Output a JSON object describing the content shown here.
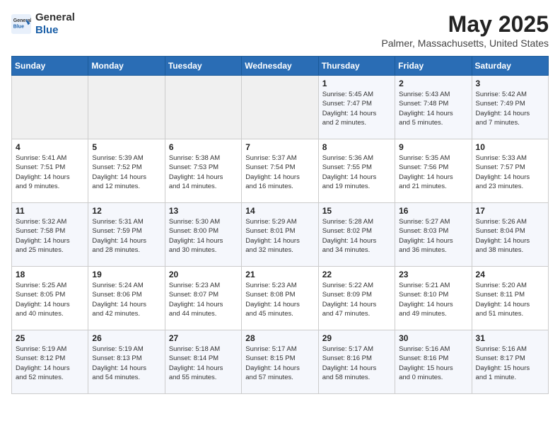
{
  "header": {
    "logo_general": "General",
    "logo_blue": "Blue",
    "month_title": "May 2025",
    "location": "Palmer, Massachusetts, United States"
  },
  "weekdays": [
    "Sunday",
    "Monday",
    "Tuesday",
    "Wednesday",
    "Thursday",
    "Friday",
    "Saturday"
  ],
  "weeks": [
    [
      {
        "day": "",
        "content": ""
      },
      {
        "day": "",
        "content": ""
      },
      {
        "day": "",
        "content": ""
      },
      {
        "day": "",
        "content": ""
      },
      {
        "day": "1",
        "content": "Sunrise: 5:45 AM\nSunset: 7:47 PM\nDaylight: 14 hours\nand 2 minutes."
      },
      {
        "day": "2",
        "content": "Sunrise: 5:43 AM\nSunset: 7:48 PM\nDaylight: 14 hours\nand 5 minutes."
      },
      {
        "day": "3",
        "content": "Sunrise: 5:42 AM\nSunset: 7:49 PM\nDaylight: 14 hours\nand 7 minutes."
      }
    ],
    [
      {
        "day": "4",
        "content": "Sunrise: 5:41 AM\nSunset: 7:51 PM\nDaylight: 14 hours\nand 9 minutes."
      },
      {
        "day": "5",
        "content": "Sunrise: 5:39 AM\nSunset: 7:52 PM\nDaylight: 14 hours\nand 12 minutes."
      },
      {
        "day": "6",
        "content": "Sunrise: 5:38 AM\nSunset: 7:53 PM\nDaylight: 14 hours\nand 14 minutes."
      },
      {
        "day": "7",
        "content": "Sunrise: 5:37 AM\nSunset: 7:54 PM\nDaylight: 14 hours\nand 16 minutes."
      },
      {
        "day": "8",
        "content": "Sunrise: 5:36 AM\nSunset: 7:55 PM\nDaylight: 14 hours\nand 19 minutes."
      },
      {
        "day": "9",
        "content": "Sunrise: 5:35 AM\nSunset: 7:56 PM\nDaylight: 14 hours\nand 21 minutes."
      },
      {
        "day": "10",
        "content": "Sunrise: 5:33 AM\nSunset: 7:57 PM\nDaylight: 14 hours\nand 23 minutes."
      }
    ],
    [
      {
        "day": "11",
        "content": "Sunrise: 5:32 AM\nSunset: 7:58 PM\nDaylight: 14 hours\nand 25 minutes."
      },
      {
        "day": "12",
        "content": "Sunrise: 5:31 AM\nSunset: 7:59 PM\nDaylight: 14 hours\nand 28 minutes."
      },
      {
        "day": "13",
        "content": "Sunrise: 5:30 AM\nSunset: 8:00 PM\nDaylight: 14 hours\nand 30 minutes."
      },
      {
        "day": "14",
        "content": "Sunrise: 5:29 AM\nSunset: 8:01 PM\nDaylight: 14 hours\nand 32 minutes."
      },
      {
        "day": "15",
        "content": "Sunrise: 5:28 AM\nSunset: 8:02 PM\nDaylight: 14 hours\nand 34 minutes."
      },
      {
        "day": "16",
        "content": "Sunrise: 5:27 AM\nSunset: 8:03 PM\nDaylight: 14 hours\nand 36 minutes."
      },
      {
        "day": "17",
        "content": "Sunrise: 5:26 AM\nSunset: 8:04 PM\nDaylight: 14 hours\nand 38 minutes."
      }
    ],
    [
      {
        "day": "18",
        "content": "Sunrise: 5:25 AM\nSunset: 8:05 PM\nDaylight: 14 hours\nand 40 minutes."
      },
      {
        "day": "19",
        "content": "Sunrise: 5:24 AM\nSunset: 8:06 PM\nDaylight: 14 hours\nand 42 minutes."
      },
      {
        "day": "20",
        "content": "Sunrise: 5:23 AM\nSunset: 8:07 PM\nDaylight: 14 hours\nand 44 minutes."
      },
      {
        "day": "21",
        "content": "Sunrise: 5:23 AM\nSunset: 8:08 PM\nDaylight: 14 hours\nand 45 minutes."
      },
      {
        "day": "22",
        "content": "Sunrise: 5:22 AM\nSunset: 8:09 PM\nDaylight: 14 hours\nand 47 minutes."
      },
      {
        "day": "23",
        "content": "Sunrise: 5:21 AM\nSunset: 8:10 PM\nDaylight: 14 hours\nand 49 minutes."
      },
      {
        "day": "24",
        "content": "Sunrise: 5:20 AM\nSunset: 8:11 PM\nDaylight: 14 hours\nand 51 minutes."
      }
    ],
    [
      {
        "day": "25",
        "content": "Sunrise: 5:19 AM\nSunset: 8:12 PM\nDaylight: 14 hours\nand 52 minutes."
      },
      {
        "day": "26",
        "content": "Sunrise: 5:19 AM\nSunset: 8:13 PM\nDaylight: 14 hours\nand 54 minutes."
      },
      {
        "day": "27",
        "content": "Sunrise: 5:18 AM\nSunset: 8:14 PM\nDaylight: 14 hours\nand 55 minutes."
      },
      {
        "day": "28",
        "content": "Sunrise: 5:17 AM\nSunset: 8:15 PM\nDaylight: 14 hours\nand 57 minutes."
      },
      {
        "day": "29",
        "content": "Sunrise: 5:17 AM\nSunset: 8:16 PM\nDaylight: 14 hours\nand 58 minutes."
      },
      {
        "day": "30",
        "content": "Sunrise: 5:16 AM\nSunset: 8:16 PM\nDaylight: 15 hours\nand 0 minutes."
      },
      {
        "day": "31",
        "content": "Sunrise: 5:16 AM\nSunset: 8:17 PM\nDaylight: 15 hours\nand 1 minute."
      }
    ]
  ]
}
